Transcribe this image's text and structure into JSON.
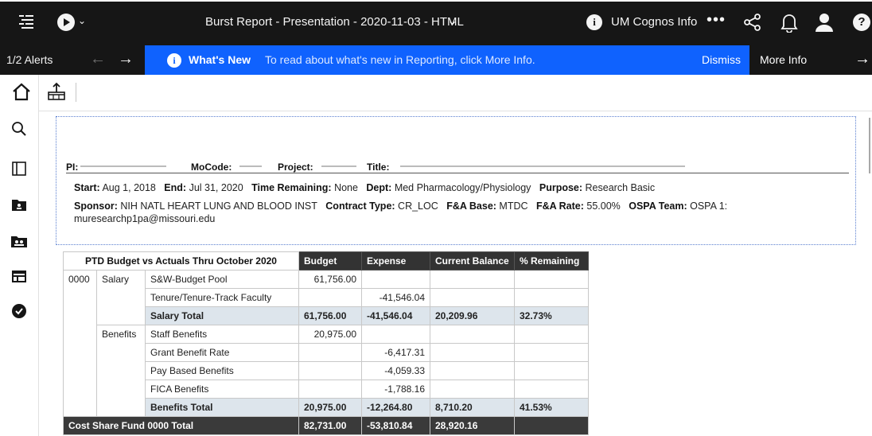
{
  "topbar": {
    "title": "Burst Report - Presentation - 2020-11-03 - HTML",
    "title_chevron": "⌄",
    "cognos_info": "UM Cognos Info",
    "more": "•••"
  },
  "alert": {
    "count": "1/2 Alerts",
    "prev": "←",
    "next": "→",
    "heading": "What's New",
    "message": "To read about what's new in Reporting, click More Info.",
    "dismiss": "Dismiss",
    "more_info": "More Info",
    "arrow": "→"
  },
  "report": {
    "headline": {
      "pi_label": "PI:",
      "mocode_label": "MoCode:",
      "project_label": "Project:",
      "title_label": "Title:"
    },
    "line1": {
      "start_label": "Start:",
      "start": "Aug 1, 2018",
      "end_label": "End:",
      "end": "Jul 31, 2020",
      "time_label": "Time Remaining:",
      "time": "None",
      "dept_label": "Dept:",
      "dept": "Med Pharmacology/Physiology",
      "purpose_label": "Purpose:",
      "purpose": "Research Basic"
    },
    "line2": {
      "sponsor_label": "Sponsor:",
      "sponsor": "NIH NATL HEART LUNG AND BLOOD INST",
      "contract_label": "Contract Type:",
      "contract": "CR_LOC",
      "fa_base_label": "F&A Base:",
      "fa_base": "MTDC",
      "fa_rate_label": "F&A Rate:",
      "fa_rate": "55.00%",
      "ospa_label": "OSPA Team:",
      "ospa": "OSPA 1:"
    },
    "line3": {
      "email": "muresearchp1pa@missouri.edu"
    }
  },
  "table": {
    "title": "PTD Budget vs Actuals Thru October 2020",
    "headers": [
      "Budget",
      "Expense",
      "Current Balance",
      "% Remaining"
    ],
    "fund": "0000",
    "salary": {
      "category": "Salary",
      "rows": [
        [
          "S&W-Budget Pool",
          "61,756.00",
          "",
          "",
          ""
        ],
        [
          "Tenure/Tenure-Track Faculty",
          "",
          "-41,546.04",
          "",
          ""
        ]
      ],
      "total": [
        "Salary Total",
        "61,756.00",
        "-41,546.04",
        "20,209.96",
        "32.73%"
      ]
    },
    "benefits": {
      "category": "Benefits",
      "rows": [
        [
          "Staff Benefits",
          "20,975.00",
          "",
          "",
          ""
        ],
        [
          "Grant Benefit Rate",
          "",
          "-6,417.31",
          "",
          ""
        ],
        [
          "Pay Based Benefits",
          "",
          "-4,059.33",
          "",
          ""
        ],
        [
          "FICA Benefits",
          "",
          "-1,788.16",
          "",
          ""
        ]
      ],
      "total": [
        "Benefits Total",
        "20,975.00",
        "-12,264.80",
        "8,710.20",
        "41.53%"
      ]
    },
    "grand_total": [
      "Cost Share Fund 0000 Total",
      "82,731.00",
      "-53,810.84",
      "28,920.16",
      ""
    ]
  }
}
